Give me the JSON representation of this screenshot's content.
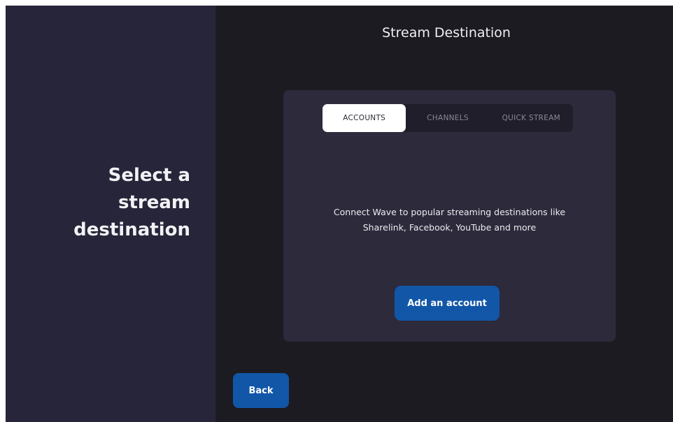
{
  "sidebar": {
    "heading_lines": [
      "Select a",
      "stream",
      "destination"
    ]
  },
  "header": {
    "title": "Stream Destination"
  },
  "card": {
    "tabs": [
      {
        "label": "ACCOUNTS",
        "active": true
      },
      {
        "label": "CHANNELS",
        "active": false
      },
      {
        "label": "QUICK STREAM",
        "active": false
      }
    ],
    "description_lines": [
      "Connect Wave to popular streaming destinations like",
      "Sharelink, Facebook, YouTube and more"
    ],
    "add_account_label": "Add an account"
  },
  "footer": {
    "back_label": "Back"
  },
  "colors": {
    "background": "#1c1b21",
    "sidebar": "#26253a",
    "card": "#2c2a3b",
    "accent": "#1256a8",
    "active_tab": "#ffffff"
  }
}
